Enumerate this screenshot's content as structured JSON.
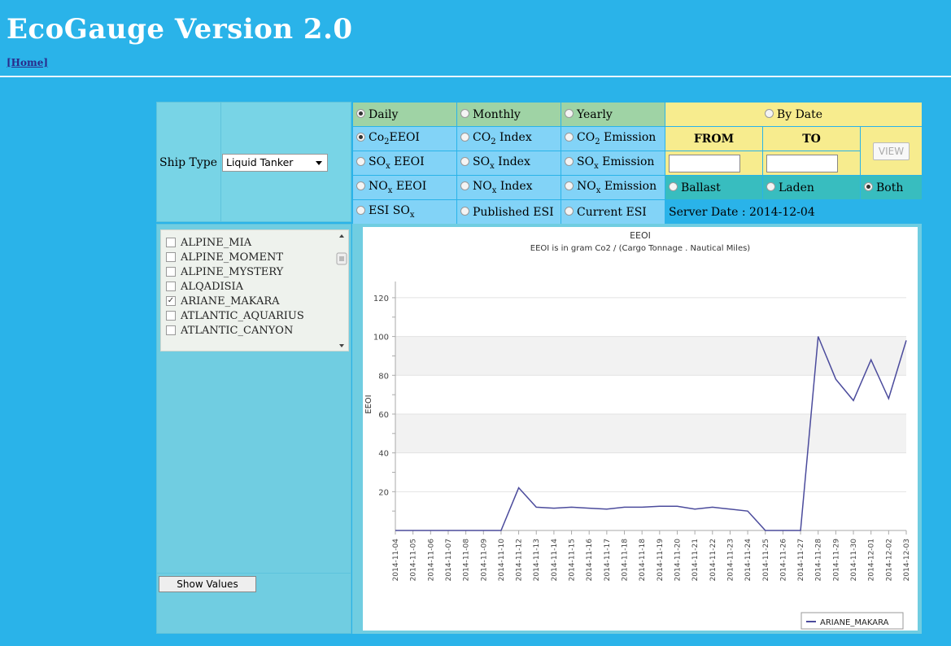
{
  "header": {
    "title": "EcoGauge Version 2.0",
    "home_link": "[Home]"
  },
  "ship_type": {
    "label": "Ship Type",
    "selected": "Liquid Tanker"
  },
  "options": {
    "period": [
      {
        "label": "Daily",
        "selected": true
      },
      {
        "label": "Monthly",
        "selected": false
      },
      {
        "label": "Yearly",
        "selected": false
      }
    ],
    "by_date": {
      "label": "By Date",
      "selected": false,
      "from_label": "FROM",
      "to_label": "TO",
      "view_label": "VIEW"
    },
    "co2": {
      "eeoi": "Co",
      "index": "CO",
      "emission": "CO",
      "sub": "2",
      "eeoi_suffix": "EEOI",
      "index_suffix": " Index",
      "emission_suffix": " Emission"
    },
    "sox": {
      "eeoi": "SO",
      "index": "SO",
      "emission": "SO",
      "sub": "x",
      "eeoi_suffix": " EEOI",
      "index_suffix": " Index",
      "emission_suffix": " Emission"
    },
    "nox": {
      "eeoi": "NO",
      "index": "NO",
      "emission": "NO",
      "sub": "x",
      "eeoi_suffix": " EEOI",
      "index_suffix": " Index",
      "emission_suffix": " Emission"
    },
    "esi": {
      "esi_sox": "ESI SO",
      "esi_sub": "x",
      "published": "Published ESI",
      "current": "Current ESI"
    },
    "load": [
      {
        "label": "Ballast",
        "selected": false
      },
      {
        "label": "Laden",
        "selected": false
      },
      {
        "label": "Both",
        "selected": true
      }
    ],
    "server_date": "Server Date : 2014-12-04"
  },
  "ships": [
    {
      "name": "ALPINE_MIA",
      "checked": false
    },
    {
      "name": "ALPINE_MOMENT",
      "checked": false
    },
    {
      "name": "ALPINE_MYSTERY",
      "checked": false
    },
    {
      "name": "ALQADISIA",
      "checked": false
    },
    {
      "name": "ARIANE_MAKARA",
      "checked": true
    },
    {
      "name": "ATLANTIC_AQUARIUS",
      "checked": false
    },
    {
      "name": "ATLANTIC_CANYON",
      "checked": false
    }
  ],
  "show_values_label": "Show Values",
  "chart_data": {
    "type": "line",
    "title": "EEOI",
    "subtitle": "EEOI is in gram Co2 / (Cargo Tonnage . Nautical Miles)",
    "xlabel": "",
    "ylabel": "EEOI",
    "ylim": [
      0,
      125
    ],
    "yticks": [
      20,
      40,
      60,
      80,
      100,
      120
    ],
    "grid": true,
    "legend_position": "bottom-right",
    "x": [
      "2014-11-04",
      "2014-11-05",
      "2014-11-06",
      "2014-11-07",
      "2014-11-08",
      "2014-11-09",
      "2014-11-10",
      "2014-11-12",
      "2014-11-13",
      "2014-11-14",
      "2014-11-15",
      "2014-11-16",
      "2014-11-17",
      "2014-11-18",
      "2014-11-18",
      "2014-11-19",
      "2014-11-20",
      "2014-11-21",
      "2014-11-22",
      "2014-11-23",
      "2014-11-24",
      "2014-11-25",
      "2014-11-26",
      "2014-11-27",
      "2014-11-28",
      "2014-11-29",
      "2014-11-30",
      "2014-12-01",
      "2014-12-02",
      "2014-12-03"
    ],
    "series": [
      {
        "name": "ARIANE_MAKARA",
        "color": "#4b4b9c",
        "values": [
          0,
          0,
          0,
          0,
          0,
          0,
          0,
          22,
          12,
          11.5,
          12,
          11.5,
          11,
          12,
          12,
          12.5,
          12.5,
          11,
          12,
          11,
          10,
          0,
          0,
          0,
          100,
          78,
          67,
          88,
          68,
          98
        ]
      }
    ]
  }
}
